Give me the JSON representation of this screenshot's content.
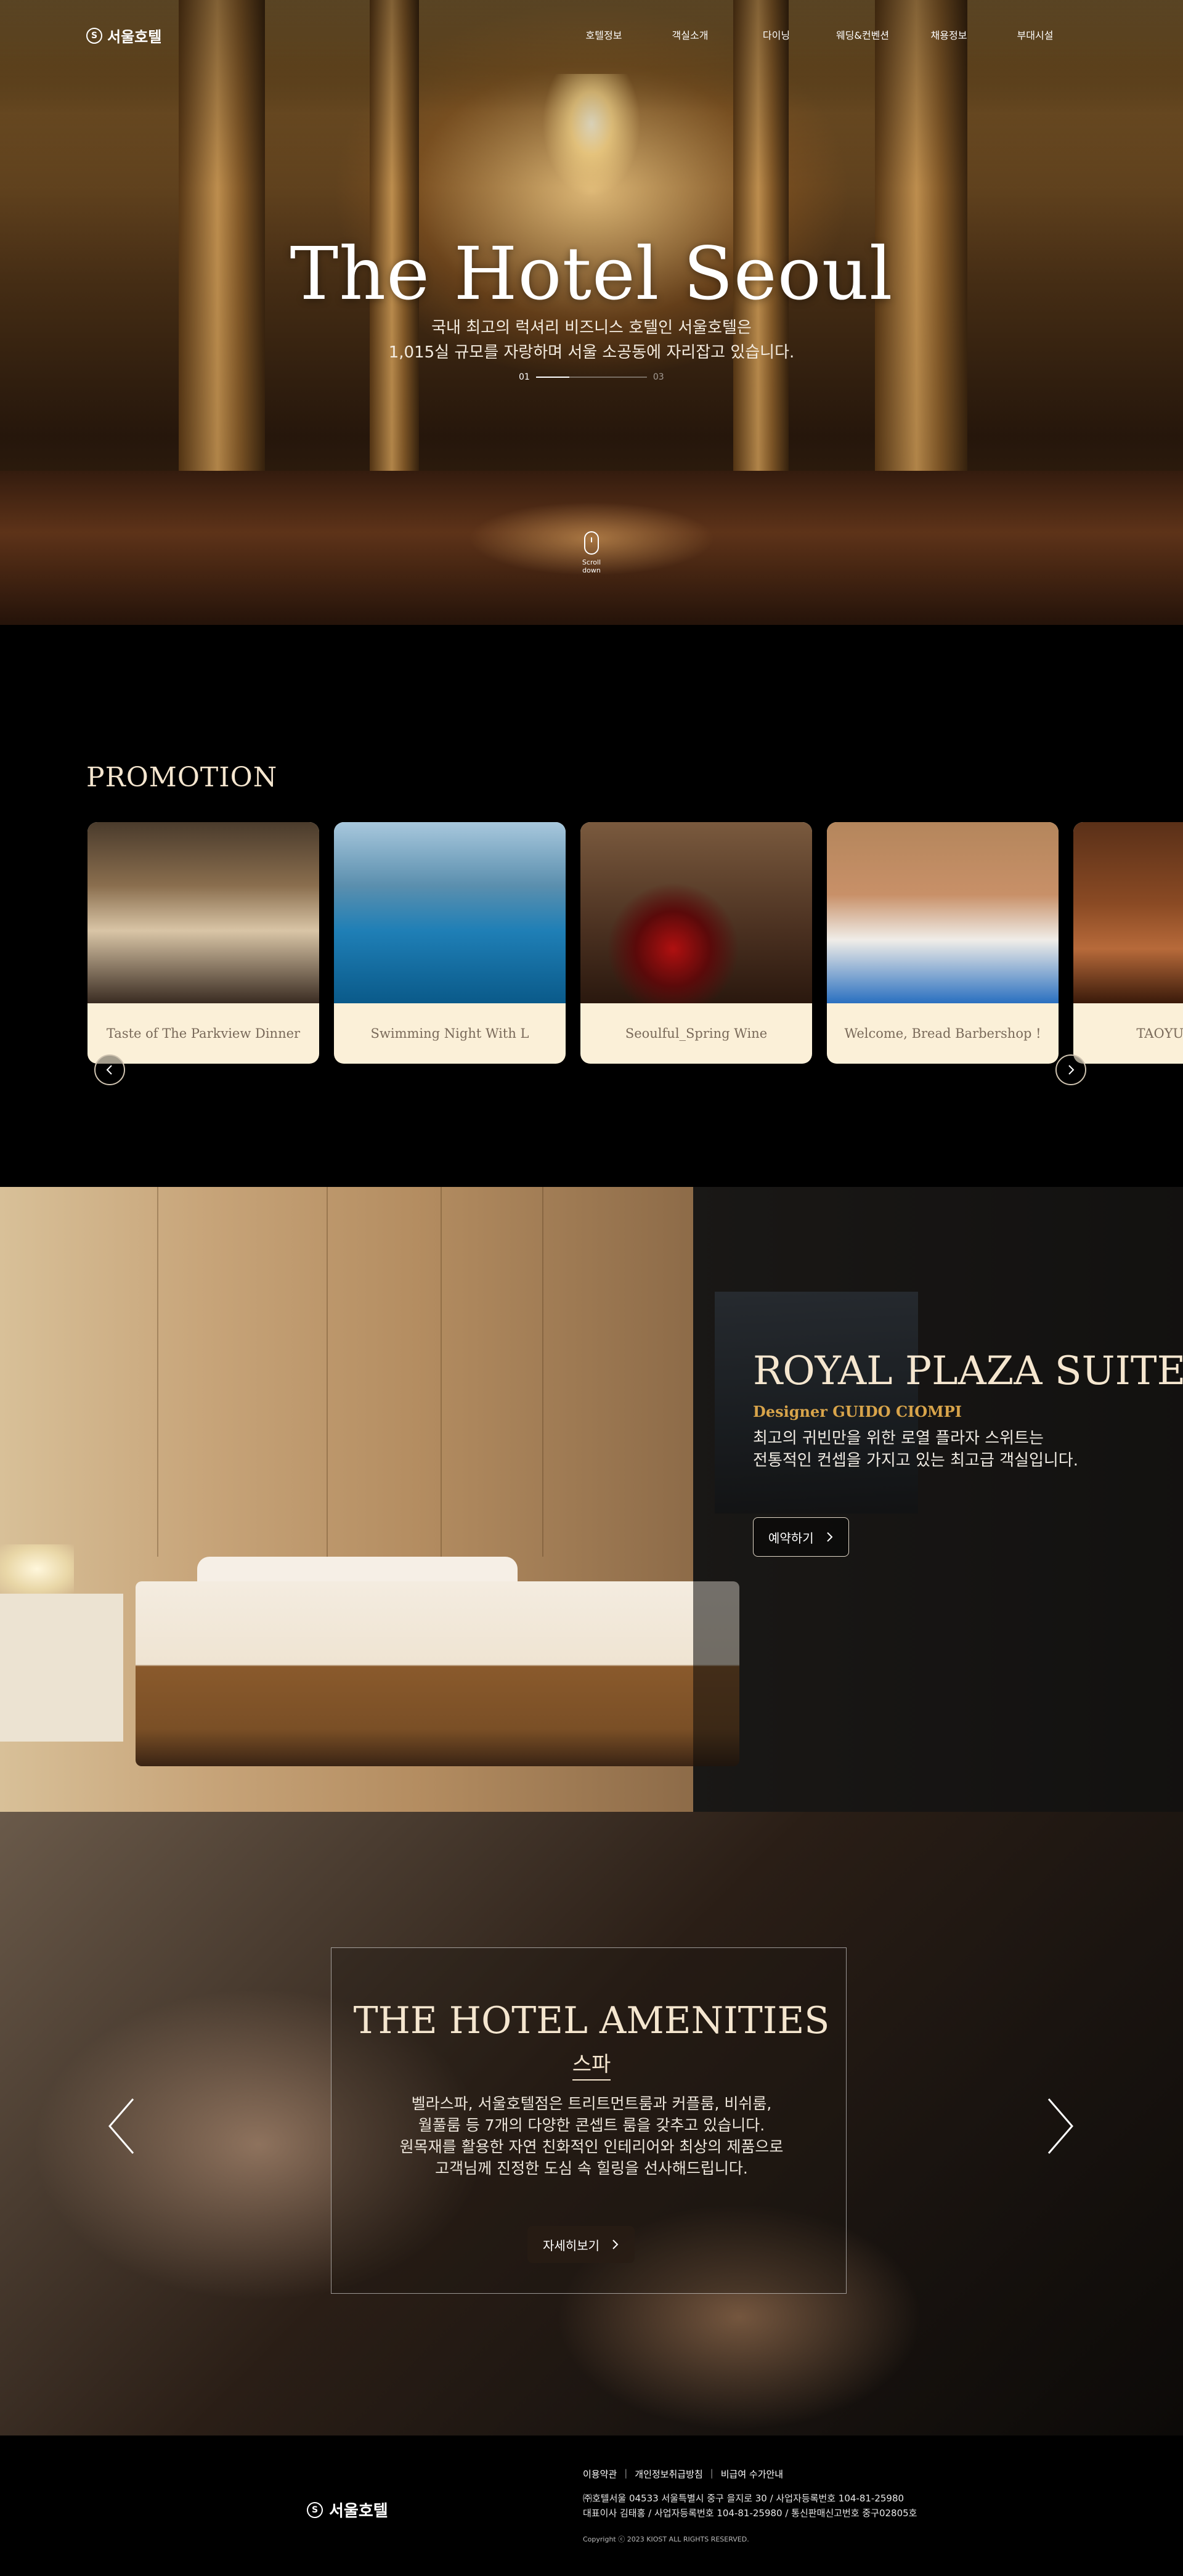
{
  "header": {
    "logo_text": "서울호텔",
    "logo_mark": "S",
    "menu": [
      "호텔정보",
      "객실소개",
      "다이닝",
      "웨딩&컨벤션",
      "채용정보",
      "부대시설"
    ]
  },
  "hero": {
    "title": "The Hotel Seoul",
    "subtitle_line1": "국내 최고의 럭셔리 비즈니스 호텔인 서울호텔은",
    "subtitle_line2": "1,015실 규모를 자랑하며 서울 소공동에 자리잡고 있습니다.",
    "pager_current": "01",
    "pager_total": "03",
    "scroll_label": "Scroll down"
  },
  "promotion": {
    "heading": "PROMOTION",
    "cards": [
      {
        "label": "Taste of The Parkview Dinner"
      },
      {
        "label": "Swimming Night With L"
      },
      {
        "label": "Seoulful_Spring Wine"
      },
      {
        "label": "Welcome, Bread Barbershop !"
      },
      {
        "label": "TAOYUEN Wine"
      }
    ]
  },
  "suite": {
    "title": "ROYAL PLAZA SUITE",
    "designer": "Designer GUIDO CIOMPI",
    "desc_line1": "최고의 귀빈만을 위한 로열 플라자 스위트는",
    "desc_line2": "전통적인 컨셉을 가지고 있는 최고급 객실입니다.",
    "button_label": "예약하기"
  },
  "amenities": {
    "title": "THE HOTEL AMENITIES",
    "subtitle": "스파",
    "desc_line1": "벨라스파, 서울호텔점은 트리트먼트룸과 커플룸, 비쉬룸,",
    "desc_line2": "월풀룸 등 7개의 다양한 콘셉트 룸을 갖추고 있습니다.",
    "desc_line3": "원목재를 활용한 자연 친화적인 인테리어와 최상의 제품으로",
    "desc_line4": "고객님께 진정한 도심 속 힐링을 선사해드립니다.",
    "button_label": "자세히보기"
  },
  "footer": {
    "logo_text": "서울호텔",
    "logo_mark": "S",
    "links": [
      "이용약관",
      "개인정보취급방침",
      "비급여 수가안내"
    ],
    "addr_line1": "㈜호텔서울 04533 서울특별시 중구 을지로 30 / 사업자등록번호 104-81-25980",
    "addr_line2": "대표이사 김태홍 / 사업자등록번호 104-81-25980 / 통신판매신고번호 중구02805호",
    "copyright": "Copyright ⓒ 2023 KIOST ALL RIGHTS RESERVED."
  },
  "colors": {
    "accent_gold": "#d8a44a",
    "cream": "#f5e6cf",
    "card_bg": "#fbf0d8"
  }
}
